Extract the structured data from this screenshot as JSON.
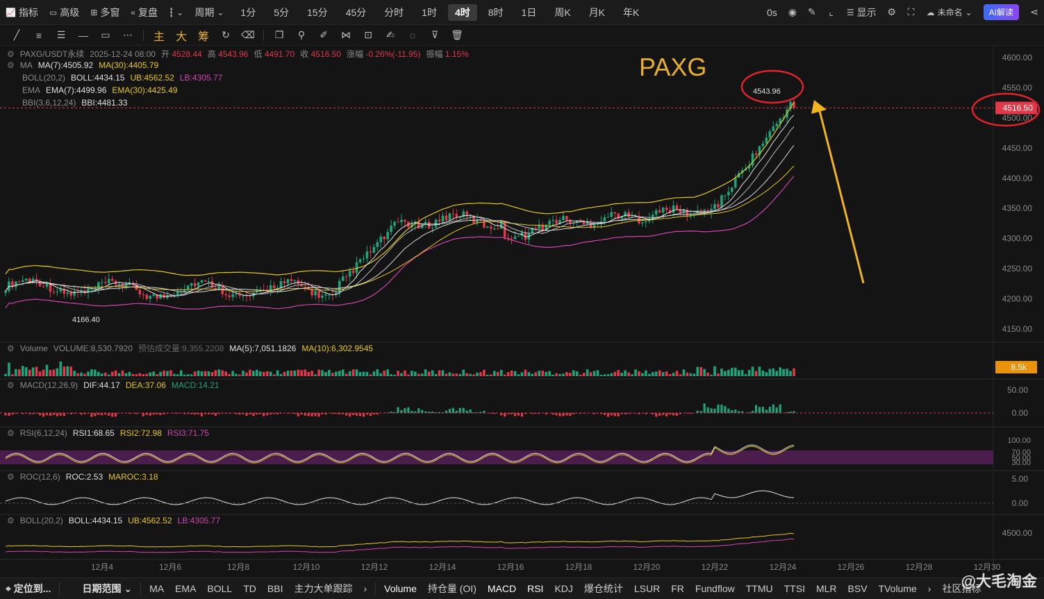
{
  "topbar": {
    "indicator": "指标",
    "advanced": "高级",
    "multi": "多窗",
    "replay": "复盘",
    "chart_type_icon": "candlestick-icon",
    "period": "周期",
    "intervals": [
      "1分",
      "5分",
      "15分",
      "45分",
      "分时",
      "1时",
      "4时",
      "8时",
      "1日",
      "周K",
      "月K",
      "年K"
    ],
    "active_interval": "4时",
    "time_zero": "0s",
    "display": "显示",
    "layout_name": "未命名",
    "ai_button": "AI解读"
  },
  "drawbar": {
    "cn_tools": [
      "主",
      "大",
      "筹"
    ]
  },
  "chart": {
    "title_annotation": "PAXG",
    "header": {
      "symbol": "PAXG/USDT永续",
      "datetime": "2025-12-24 08:00",
      "open_label": "开",
      "open": "4528.44",
      "high_label": "高",
      "high": "4543.96",
      "low_label": "低",
      "low": "4491.70",
      "close_label": "收",
      "close": "4516.50",
      "change_label": "涨幅",
      "change": "-0.26%(-11.95)",
      "amplitude_label": "振幅",
      "amplitude": "1.15%"
    },
    "ma": {
      "label": "MA",
      "ma7": "MA(7):4505.92",
      "ma30": "MA(30):4405.79"
    },
    "boll": {
      "label": "BOLL(20,2)",
      "mid": "BOLL:4434.15",
      "ub": "UB:4562.52",
      "lb": "LB:4305.77"
    },
    "ema": {
      "label": "EMA",
      "ema7": "EMA(7):4499.96",
      "ema30": "EMA(30):4425.49"
    },
    "bbi": {
      "label": "BBI(3,6,12,24)",
      "value": "BBI:4481.33"
    },
    "high_mark": "4543.96",
    "low_mark": "4166.40",
    "price_tag": "4516.50",
    "price_axis": [
      "4600.00",
      "4550.00",
      "4500.00",
      "4450.00",
      "4400.00",
      "4350.00",
      "4300.00",
      "4250.00",
      "4200.00",
      "4150.00"
    ],
    "volume": {
      "label": "Volume",
      "value": "VOLUME:8,530.7920",
      "est_label": "预估成交量:9,355.2208",
      "ma5": "MA(5):7,051.1826",
      "ma10": "MA(10):6,302.9545",
      "tag": "8.5k"
    },
    "macd": {
      "label": "MACD(12,26,9)",
      "dif": "DIF:44.17",
      "dea": "DEA:37.06",
      "macd": "MACD:14.21",
      "axis": [
        "50.00",
        "0.00"
      ]
    },
    "rsi": {
      "label": "RSI(6,12,24)",
      "rsi1": "RSI1:68.65",
      "rsi2": "RSI2:72.98",
      "rsi3": "RSI3:71.75",
      "axis": [
        "100.00",
        "70.00",
        "50.00",
        "30.00"
      ]
    },
    "roc": {
      "label": "ROC(12,6)",
      "roc": "ROC:2.53",
      "maroc": "MAROC:3.18",
      "axis": [
        "5.00",
        "0.00"
      ]
    },
    "boll2": {
      "label": "BOLL(20,2)",
      "mid": "BOLL:4434.15",
      "ub": "UB:4562.52",
      "lb": "LB:4305.77",
      "axis": [
        "4500.00"
      ]
    },
    "dates": [
      "12月4",
      "12月6",
      "12月8",
      "12月10",
      "12月12",
      "12月14",
      "12月16",
      "12月18",
      "12月20",
      "12月22",
      "12月24",
      "12月26",
      "12月28",
      "12月30"
    ]
  },
  "bottombar": {
    "locate": "定位到...",
    "date_range": "日期范围",
    "overlays": [
      "MA",
      "EMA",
      "BOLL",
      "TD",
      "BBI",
      "主力大单跟踪"
    ],
    "subcharts": [
      "Volume",
      "持仓量 (OI)",
      "MACD",
      "RSI",
      "KDJ",
      "爆仓统计",
      "LSUR",
      "FR",
      "Fundflow",
      "TTMU",
      "TTSI",
      "MLR",
      "BSV",
      "TVolume"
    ],
    "community": "社区指标"
  },
  "watermark": "@大毛淘金",
  "colors": {
    "up": "#1fa37a",
    "down": "#e0394a",
    "yellow": "#e8c81a",
    "magenta": "#d246b4",
    "accent": "#e8b030",
    "circle": "#e0232e"
  }
}
